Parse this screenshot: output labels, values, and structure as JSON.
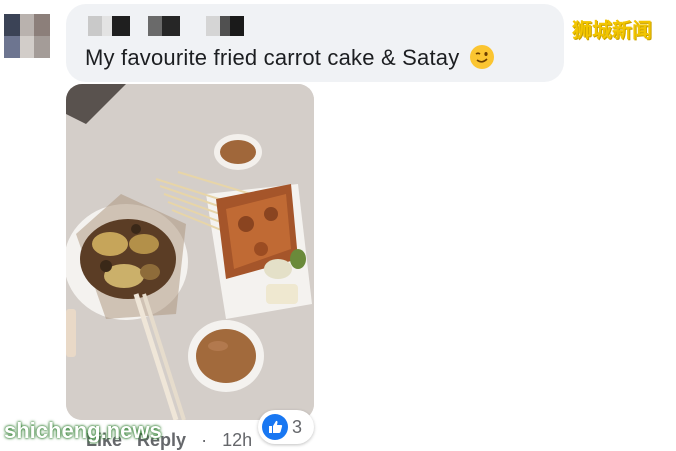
{
  "comment": {
    "author_censored": true,
    "text": "My favourite fried carrot cake & Satay",
    "emoji": "wink-emoji",
    "watermark": "狮城新闻"
  },
  "photo": {
    "subject": "food-photo"
  },
  "actions": {
    "like_label": "Like",
    "reply_label": "Reply",
    "separator": "·",
    "time": "12h"
  },
  "reactions": {
    "icon": "thumbs-up-icon",
    "count": "3",
    "color": "#1877f2"
  },
  "site_watermark": "shicheng.news",
  "colors": {
    "bubble": "#f0f2f5",
    "text": "#1c1e21",
    "secondary": "#65676b"
  }
}
